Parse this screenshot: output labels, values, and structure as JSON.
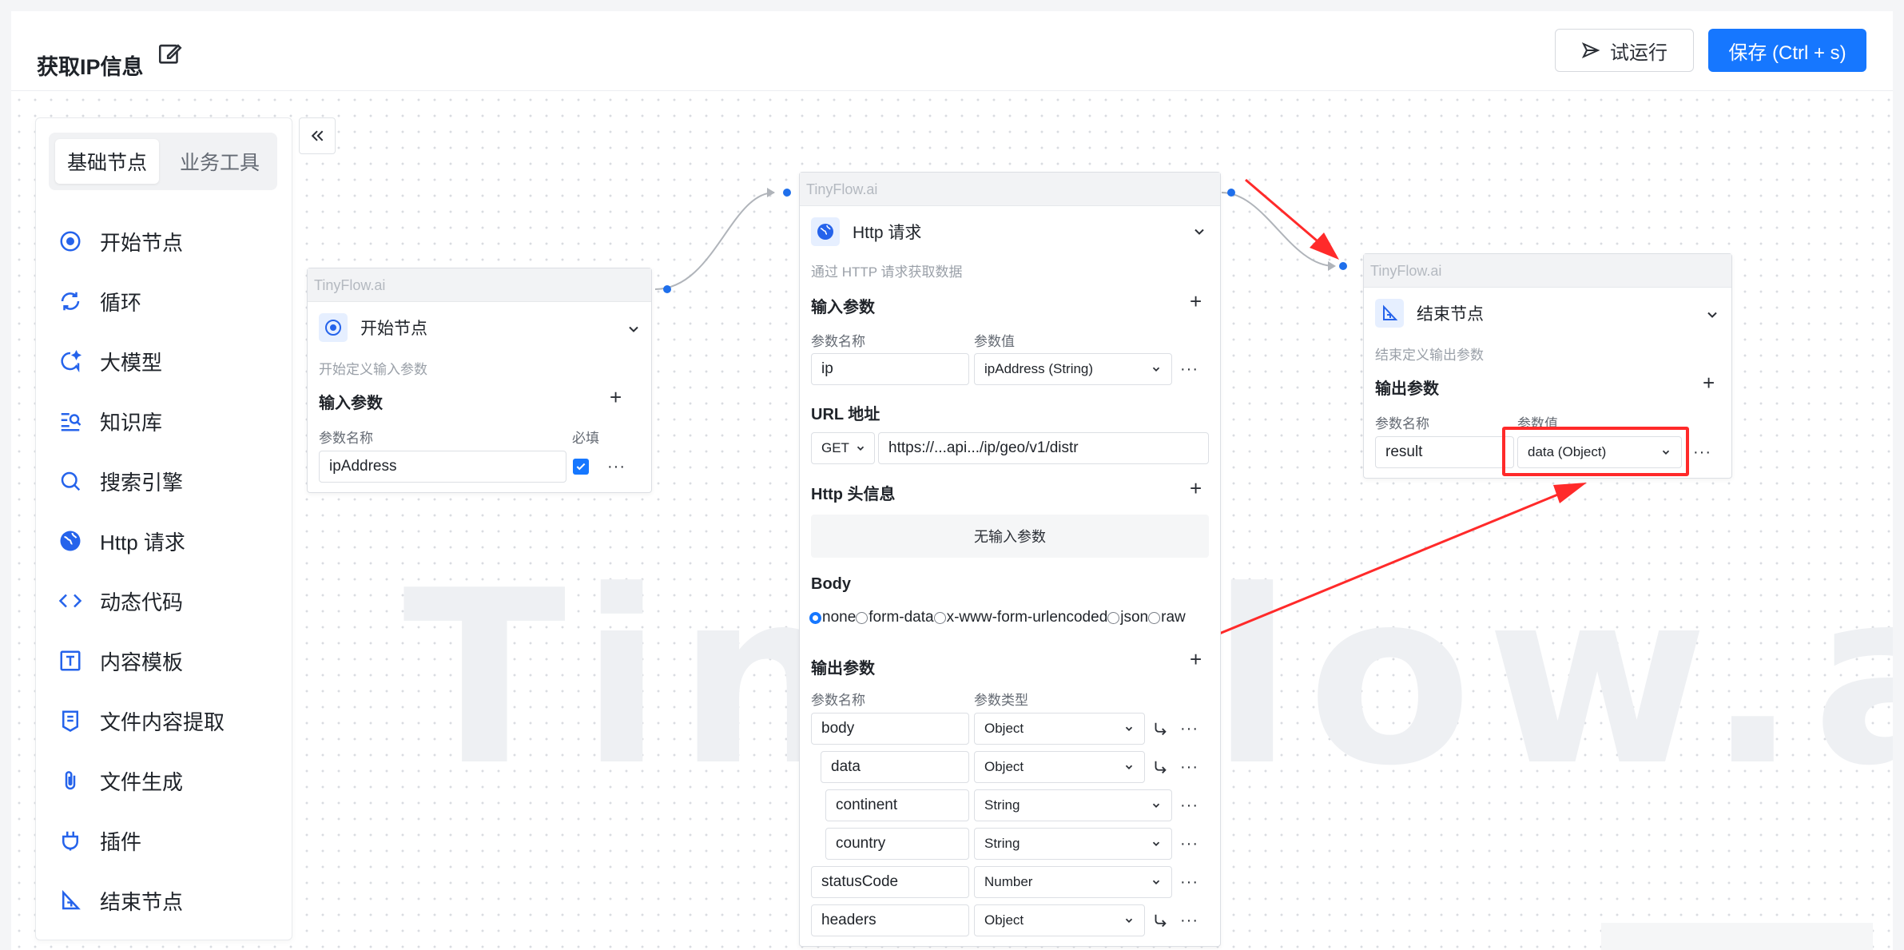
{
  "header": {
    "title": "获取IP信息",
    "run_label": "试运行",
    "save_label": "保存 (Ctrl + s)"
  },
  "sidebar": {
    "tabs": [
      "基础节点",
      "业务工具"
    ],
    "items": [
      {
        "label": "开始节点",
        "icon": "start-icon"
      },
      {
        "label": "循环",
        "icon": "loop-icon"
      },
      {
        "label": "大模型",
        "icon": "llm-icon"
      },
      {
        "label": "知识库",
        "icon": "knowledge-icon"
      },
      {
        "label": "搜索引擎",
        "icon": "search-icon"
      },
      {
        "label": "Http 请求",
        "icon": "globe-icon"
      },
      {
        "label": "动态代码",
        "icon": "code-icon"
      },
      {
        "label": "内容模板",
        "icon": "template-icon"
      },
      {
        "label": "文件内容提取",
        "icon": "file-extract-icon"
      },
      {
        "label": "文件生成",
        "icon": "paperclip-icon"
      },
      {
        "label": "插件",
        "icon": "plugin-icon"
      },
      {
        "label": "结束节点",
        "icon": "end-icon"
      }
    ]
  },
  "watermark": "TinyFlow.ai",
  "start_node": {
    "brand": "TinyFlow.ai",
    "title": "开始节点",
    "desc": "开始定义输入参数",
    "input_section": "输入参数",
    "col_name": "参数名称",
    "col_required": "必填",
    "param_name": "ipAddress",
    "required": true
  },
  "http_node": {
    "brand": "TinyFlow.ai",
    "title": "Http 请求",
    "desc": "通过 HTTP 请求获取数据",
    "input_section": "输入参数",
    "col_name": "参数名称",
    "col_value": "参数值",
    "input_name": "ip",
    "input_value": "ipAddress (String)",
    "url_section": "URL 地址",
    "method": "GET",
    "url": "https://...api.../ip/geo/v1/distr",
    "header_section": "Http 头信息",
    "no_params": "无输入参数",
    "body_section": "Body",
    "body_options": [
      "none",
      "form-data",
      "x-www-form-urlencoded",
      "json",
      "raw"
    ],
    "body_selected": "none",
    "output_section": "输出参数",
    "col_type": "参数类型",
    "outputs": [
      {
        "name": "body",
        "type": "Object"
      },
      {
        "name": "data",
        "type": "Object"
      },
      {
        "name": "continent",
        "type": "String"
      },
      {
        "name": "country",
        "type": "String"
      },
      {
        "name": "statusCode",
        "type": "Number"
      },
      {
        "name": "headers",
        "type": "Object"
      }
    ]
  },
  "end_node": {
    "brand": "TinyFlow.ai",
    "title": "结束节点",
    "desc": "结束定义输出参数",
    "output_section": "输出参数",
    "col_name": "参数名称",
    "col_value": "参数值",
    "param_name": "result",
    "param_value": "data (Object)"
  },
  "colors": {
    "accent": "#1677ff",
    "annotation": "#ff2a2a"
  }
}
